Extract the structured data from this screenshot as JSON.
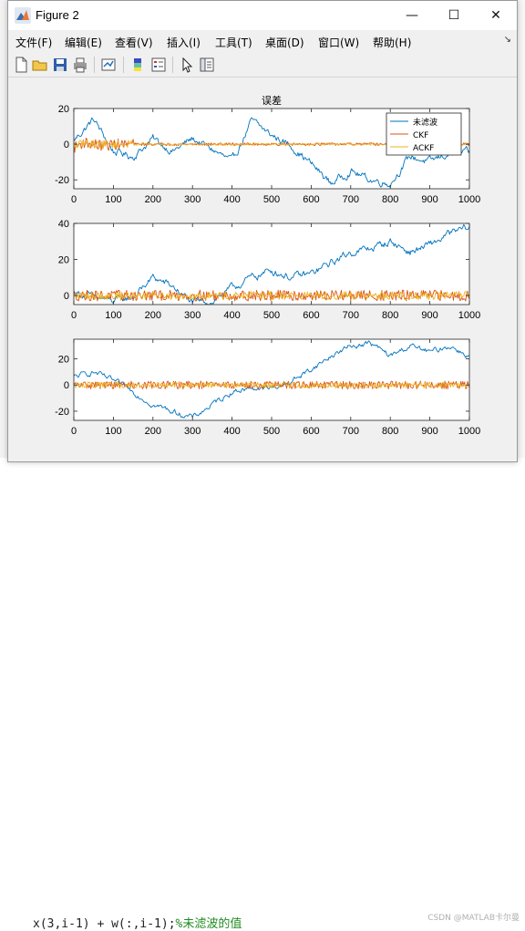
{
  "window": {
    "title": "Figure 2",
    "minimize_glyph": "—",
    "maximize_glyph": "☐",
    "close_glyph": "✕"
  },
  "menu": [
    {
      "label": "文件(F)"
    },
    {
      "label": "编辑(E)"
    },
    {
      "label": "查看(V)"
    },
    {
      "label": "插入(I)"
    },
    {
      "label": "工具(T)"
    },
    {
      "label": "桌面(D)"
    },
    {
      "label": "窗口(W)"
    },
    {
      "label": "帮助(H)"
    }
  ],
  "toolbar_icons": [
    "new-figure-icon",
    "open-folder-icon",
    "save-icon",
    "print-icon",
    "link-plot-icon",
    "insert-colorbar-icon",
    "insert-legend-icon",
    "edit-pointer-icon",
    "property-inspector-icon"
  ],
  "background": {
    "code_text": "x(3,i-1) + w(:,i-1);",
    "code_comment": "%未滤波的值",
    "watermark": "CSDN @MATLAB卡尔曼"
  },
  "colors": {
    "series1": "#0072BD",
    "series2": "#D95319",
    "series3": "#EDB120",
    "axes": "#262626",
    "figure_bg": "#f0f0f0"
  },
  "chart_data": [
    {
      "type": "line",
      "title": "误差",
      "xlim": [
        0,
        1000
      ],
      "ylim": [
        -25,
        20
      ],
      "xticks": [
        0,
        100,
        200,
        300,
        400,
        500,
        600,
        700,
        800,
        900,
        1000
      ],
      "yticks": [
        -20,
        0,
        20
      ],
      "legend": {
        "location": "top-right",
        "entries": [
          "未滤波",
          "CKF",
          "ACKF"
        ]
      },
      "series": [
        {
          "name": "未滤波",
          "x": [
            0,
            50,
            100,
            150,
            200,
            250,
            300,
            350,
            400,
            450,
            500,
            550,
            600,
            650,
            700,
            750,
            800,
            850,
            900,
            950,
            1000
          ],
          "y": [
            2,
            14,
            -4,
            -7,
            3,
            -4,
            3,
            -3,
            -10,
            13,
            5,
            -1,
            -11,
            -22,
            -15,
            -20,
            -22,
            -7,
            -10,
            -5,
            -5
          ]
        },
        {
          "name": "CKF",
          "x": [
            0,
            25,
            50,
            75,
            100,
            150,
            200,
            300,
            400,
            500,
            600,
            700,
            800,
            900,
            1000
          ],
          "y": [
            -2,
            1,
            0,
            -1,
            0,
            0,
            0,
            0,
            0,
            0,
            0,
            0,
            0,
            0,
            0
          ]
        },
        {
          "name": "ACKF",
          "x": [
            0,
            25,
            50,
            75,
            100,
            150,
            200,
            300,
            400,
            500,
            600,
            700,
            800,
            900,
            1000
          ],
          "y": [
            -1,
            0.5,
            0,
            0,
            0,
            0,
            0,
            0,
            0,
            0,
            0,
            0,
            0,
            0,
            0
          ]
        }
      ]
    },
    {
      "type": "line",
      "xlim": [
        0,
        1000
      ],
      "ylim": [
        -5,
        40
      ],
      "xticks": [
        0,
        100,
        200,
        300,
        400,
        500,
        600,
        700,
        800,
        900,
        1000
      ],
      "yticks": [
        0,
        20,
        40
      ],
      "series": [
        {
          "x": [
            0,
            50,
            100,
            150,
            200,
            250,
            300,
            350,
            400,
            450,
            500,
            550,
            600,
            650,
            700,
            750,
            800,
            850,
            900,
            950,
            1000
          ],
          "y": [
            2,
            -1,
            -3,
            -1,
            10,
            5,
            -4,
            -3,
            4,
            10,
            14,
            10,
            12,
            18,
            24,
            26,
            30,
            24,
            28,
            34,
            38
          ]
        },
        {
          "x": [
            0,
            100,
            200,
            300,
            400,
            500,
            600,
            700,
            800,
            900,
            1000
          ],
          "y": [
            0,
            0,
            0,
            0,
            0,
            0,
            0,
            0,
            0,
            0,
            0
          ]
        },
        {
          "x": [
            0,
            100,
            200,
            300,
            400,
            500,
            600,
            700,
            800,
            900,
            1000
          ],
          "y": [
            0,
            0,
            0,
            0,
            0,
            0,
            0,
            0,
            0,
            0,
            0
          ]
        }
      ]
    },
    {
      "type": "line",
      "xlim": [
        0,
        1000
      ],
      "ylim": [
        -27,
        35
      ],
      "xticks": [
        0,
        100,
        200,
        300,
        400,
        500,
        600,
        700,
        800,
        900,
        1000
      ],
      "yticks": [
        -20,
        0,
        20
      ],
      "series": [
        {
          "x": [
            0,
            50,
            100,
            150,
            200,
            250,
            300,
            350,
            400,
            450,
            500,
            550,
            600,
            650,
            700,
            750,
            800,
            850,
            900,
            950,
            1000
          ],
          "y": [
            6,
            10,
            3,
            -5,
            -15,
            -20,
            -25,
            -15,
            -5,
            -2,
            -3,
            3,
            12,
            22,
            30,
            32,
            22,
            30,
            25,
            30,
            22
          ]
        },
        {
          "x": [
            0,
            100,
            200,
            300,
            400,
            500,
            600,
            700,
            800,
            900,
            1000
          ],
          "y": [
            0,
            0,
            0,
            0,
            0,
            0,
            0,
            0,
            0,
            0,
            0
          ]
        },
        {
          "x": [
            0,
            100,
            200,
            300,
            400,
            500,
            600,
            700,
            800,
            900,
            1000
          ],
          "y": [
            0,
            0,
            0,
            0,
            0,
            0,
            0,
            0,
            0,
            0,
            0
          ]
        }
      ]
    }
  ]
}
